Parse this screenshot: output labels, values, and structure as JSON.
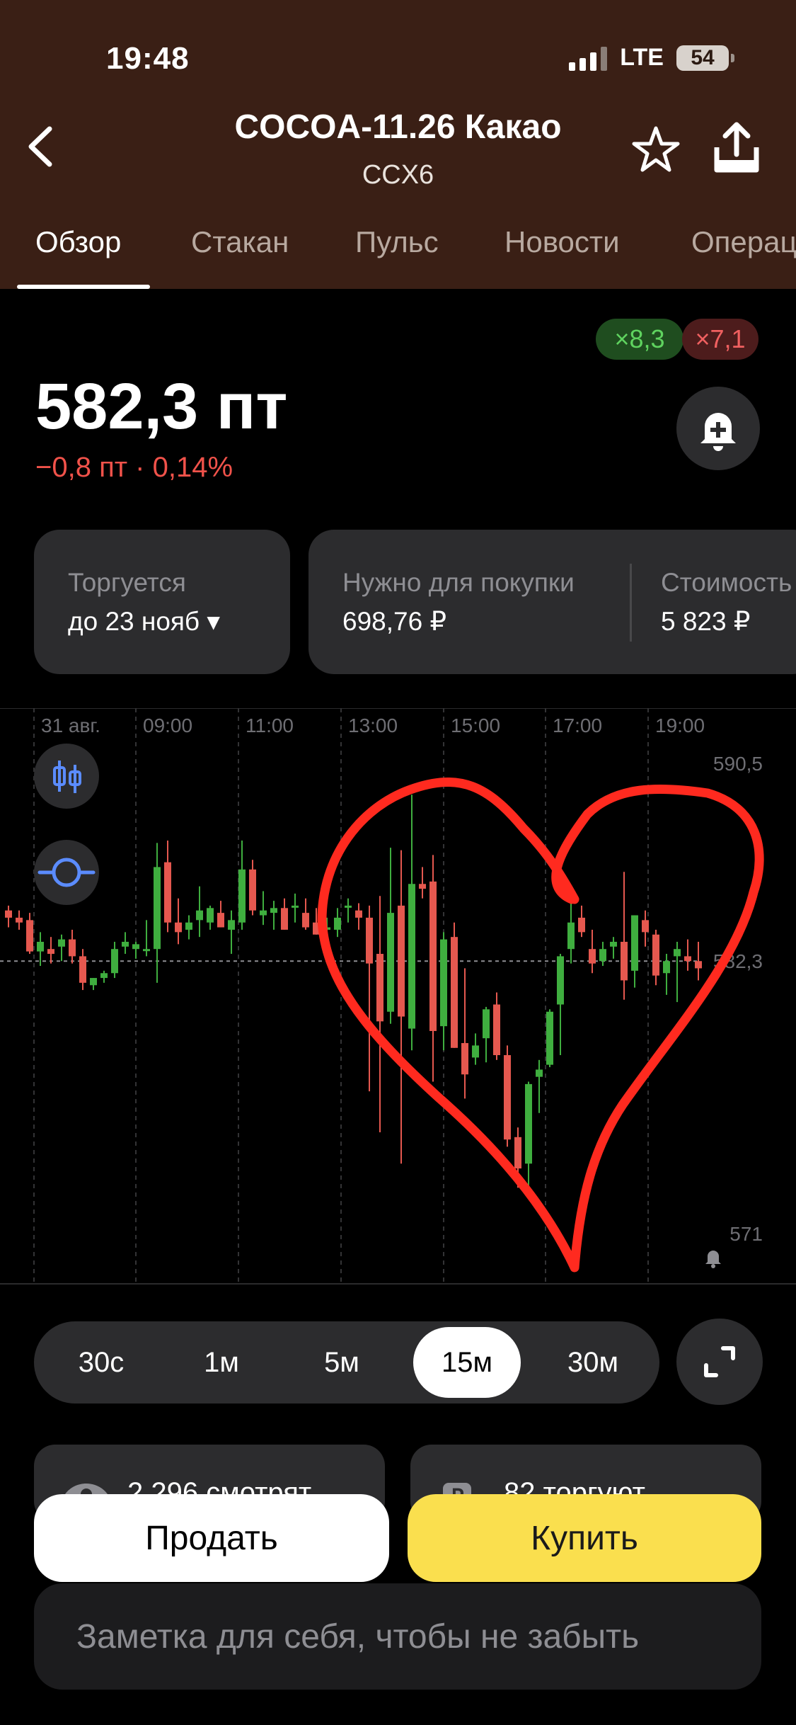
{
  "status": {
    "time": "19:48",
    "network": "LTE",
    "battery": "54"
  },
  "header": {
    "title": "COCOA-11.26 Какао",
    "subtitle": "CCX6",
    "tabs": [
      {
        "label": "Обзор",
        "active": true
      },
      {
        "label": "Стакан"
      },
      {
        "label": "Пульс"
      },
      {
        "label": "Новости"
      },
      {
        "label": "Операции"
      }
    ]
  },
  "quote": {
    "badge_green": "×8,3",
    "badge_red": "×7,1",
    "price": "582,3 пт",
    "change": "−0,8 пт · 0,14%"
  },
  "cards": {
    "trading_label": "Торгуется",
    "trading_value": "до 23 нояб ▾",
    "required_label": "Нужно для покупки",
    "required_value": "698,76 ₽",
    "cost_label": "Стоимость",
    "cost_value": "5 823 ₽"
  },
  "chart_data": {
    "type": "candlestick",
    "x_ticks": [
      "31 авг.",
      "09:00",
      "11:00",
      "13:00",
      "15:00",
      "17:00",
      "19:00"
    ],
    "y_labels": [
      "590,5",
      "582,3",
      "571"
    ],
    "current_price": 582.3,
    "ylim": [
      571,
      590.5
    ],
    "candles": [
      [
        584.4,
        584.6,
        583.7,
        584.1
      ],
      [
        584.1,
        584.4,
        583.6,
        583.9
      ],
      [
        584.0,
        584.3,
        582.6,
        582.7
      ],
      [
        582.7,
        583.5,
        582.1,
        583.1
      ],
      [
        582.8,
        583.3,
        582.2,
        582.6
      ],
      [
        582.9,
        583.4,
        582.3,
        583.2
      ],
      [
        583.2,
        583.6,
        582.2,
        582.5
      ],
      [
        582.5,
        582.8,
        581.1,
        581.4
      ],
      [
        581.3,
        581.6,
        581.1,
        581.6
      ],
      [
        581.6,
        581.9,
        581.4,
        581.8
      ],
      [
        581.8,
        583.1,
        581.6,
        582.8
      ],
      [
        582.9,
        583.5,
        582.6,
        583.1
      ],
      [
        582.8,
        583.1,
        582.4,
        583.0
      ],
      [
        582.8,
        584.0,
        582.5,
        582.8
      ],
      [
        582.8,
        587.2,
        581.4,
        586.2
      ],
      [
        586.4,
        587.3,
        583.5,
        583.9
      ],
      [
        583.9,
        584.9,
        583.0,
        583.5
      ],
      [
        583.6,
        584.2,
        583.2,
        583.9
      ],
      [
        584.0,
        585.4,
        583.3,
        584.4
      ],
      [
        583.9,
        584.6,
        583.6,
        584.5
      ],
      [
        584.3,
        584.8,
        583.7,
        583.7
      ],
      [
        583.6,
        584.4,
        582.6,
        584.0
      ],
      [
        583.9,
        587.3,
        583.6,
        586.1
      ],
      [
        586.1,
        586.5,
        584.2,
        584.4
      ],
      [
        584.2,
        585.2,
        583.8,
        584.4
      ],
      [
        584.3,
        584.8,
        583.6,
        584.5
      ],
      [
        584.5,
        584.9,
        583.6,
        583.6
      ],
      [
        584.6,
        585.1,
        583.9,
        584.6
      ],
      [
        584.3,
        584.9,
        583.6,
        583.7
      ],
      [
        583.9,
        584.5,
        583.4,
        583.4
      ],
      [
        583.6,
        584.1,
        583.3,
        583.7
      ],
      [
        583.6,
        584.5,
        583.3,
        584.1
      ],
      [
        584.6,
        584.9,
        583.9,
        584.6
      ],
      [
        584.4,
        584.7,
        583.6,
        584.1
      ],
      [
        584.1,
        584.6,
        576.9,
        582.2
      ],
      [
        582.6,
        585.0,
        575.2,
        579.8
      ],
      [
        580.2,
        587.0,
        579.7,
        584.3
      ],
      [
        584.6,
        586.9,
        573.9,
        580.0
      ],
      [
        579.5,
        589.2,
        578.6,
        585.5
      ],
      [
        585.5,
        586.2,
        584.9,
        585.3
      ],
      [
        585.6,
        586.7,
        577.3,
        579.4
      ],
      [
        579.6,
        583.5,
        578.6,
        583.2
      ],
      [
        583.3,
        583.9,
        578.7,
        578.7
      ],
      [
        578.9,
        582.0,
        576.6,
        577.6
      ],
      [
        578.3,
        579.3,
        578.0,
        578.8
      ],
      [
        579.1,
        580.4,
        578.1,
        580.3
      ],
      [
        580.5,
        581.0,
        578.2,
        578.4
      ],
      [
        578.4,
        578.8,
        574.6,
        574.9
      ],
      [
        575.0,
        575.4,
        572.9,
        573.7
      ],
      [
        573.9,
        577.3,
        572.5,
        577.2
      ],
      [
        577.5,
        578.2,
        576.0,
        577.8
      ],
      [
        578.0,
        580.3,
        577.9,
        580.2
      ],
      [
        580.5,
        582.6,
        578.4,
        582.5
      ],
      [
        582.8,
        584.7,
        582.2,
        583.9
      ],
      [
        584.1,
        584.6,
        583.3,
        583.5
      ],
      [
        582.8,
        583.6,
        581.8,
        582.2
      ],
      [
        582.3,
        583.1,
        582.1,
        582.8
      ],
      [
        582.9,
        583.3,
        582.4,
        583.1
      ],
      [
        583.1,
        586.0,
        580.7,
        581.5
      ],
      [
        581.9,
        584.2,
        581.2,
        584.2
      ],
      [
        584.0,
        584.4,
        582.9,
        583.5
      ],
      [
        583.4,
        583.6,
        581.3,
        581.7
      ],
      [
        581.8,
        582.6,
        580.9,
        582.3
      ],
      [
        582.5,
        583.1,
        580.6,
        582.8
      ],
      [
        582.5,
        583.2,
        581.9,
        582.3
      ],
      [
        582.3,
        583.1,
        581.5,
        582.0
      ]
    ]
  },
  "timeframes": [
    {
      "label": "30с"
    },
    {
      "label": "1м"
    },
    {
      "label": "5м"
    },
    {
      "label": "15м",
      "active": true
    },
    {
      "label": "30м"
    }
  ],
  "social": {
    "viewers": "2 296 смотрят",
    "traders": "82 торгуют"
  },
  "actions": {
    "sell": "Продать",
    "buy": "Купить"
  },
  "note": {
    "placeholder": "Заметка для себя, чтобы не забыть"
  },
  "colors": {
    "up": "#3fae3f",
    "down": "#e5584f",
    "annotation": "#ff2a1f",
    "header_bg": "#3a1f15",
    "buy": "#fadf4e"
  }
}
